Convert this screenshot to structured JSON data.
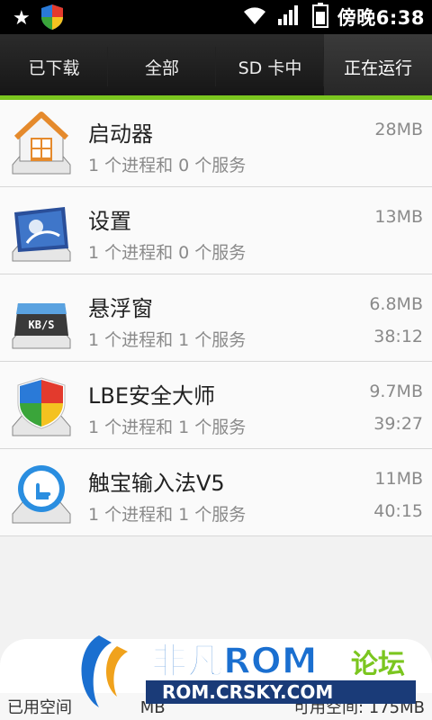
{
  "status": {
    "time": "傍晚6:38"
  },
  "tabs": [
    "已下载",
    "全部",
    "SD 卡中",
    "正在运行"
  ],
  "apps": [
    {
      "name": "启动器",
      "desc": "1 个进程和 0 个服务",
      "size": "28MB",
      "time": ""
    },
    {
      "name": "设置",
      "desc": "1 个进程和 0 个服务",
      "size": "13MB",
      "time": ""
    },
    {
      "name": "悬浮窗",
      "desc": "1 个进程和 1 个服务",
      "size": "6.8MB",
      "time": "38:12"
    },
    {
      "name": "LBE安全大师",
      "desc": "1 个进程和 1 个服务",
      "size": "9.7MB",
      "time": "39:27"
    },
    {
      "name": "触宝输入法V5",
      "desc": "1 个进程和 1 个服务",
      "size": "11MB",
      "time": "40:15"
    }
  ],
  "footer": {
    "left": "已用空间",
    "left_value": "MB",
    "right": "可用空间",
    "right_value": "175MB"
  },
  "watermark": {
    "brand": "非凡ROM",
    "suffix": "论坛",
    "url": "ROM.CRSKY.COM"
  }
}
